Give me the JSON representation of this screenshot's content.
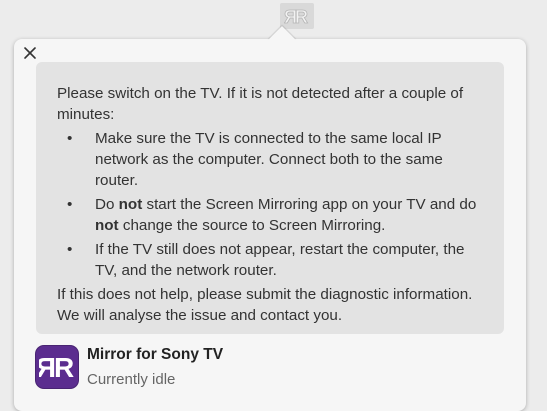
{
  "menubar": {
    "icon": "mirror-app-icon"
  },
  "popover": {
    "close_icon": "close-icon",
    "intro": "Please switch on the TV. If it is not detected after a couple of minutes:",
    "bullets": [
      {
        "parts": [
          "Make sure the TV is connected to the same local IP network as the computer. Connect both to the same router."
        ]
      },
      {
        "p1": "Do ",
        "b1": "not",
        "p2": " start the Screen Mirroring app on your TV and do ",
        "b2": "not",
        "p3": " change the source to Screen Mirroring."
      },
      {
        "parts": [
          "If the TV still does not appear, restart the computer, the TV, and the network router."
        ]
      }
    ],
    "bullet_glyph": "•",
    "footer": "If this does not help, please submit the diagnostic information. We will analyse the issue and contact you."
  },
  "app": {
    "icon": "mirror-for-sony-tv-icon",
    "icon_color": "#5b2d8f",
    "name": "Mirror for Sony TV",
    "status": "Currently idle"
  }
}
